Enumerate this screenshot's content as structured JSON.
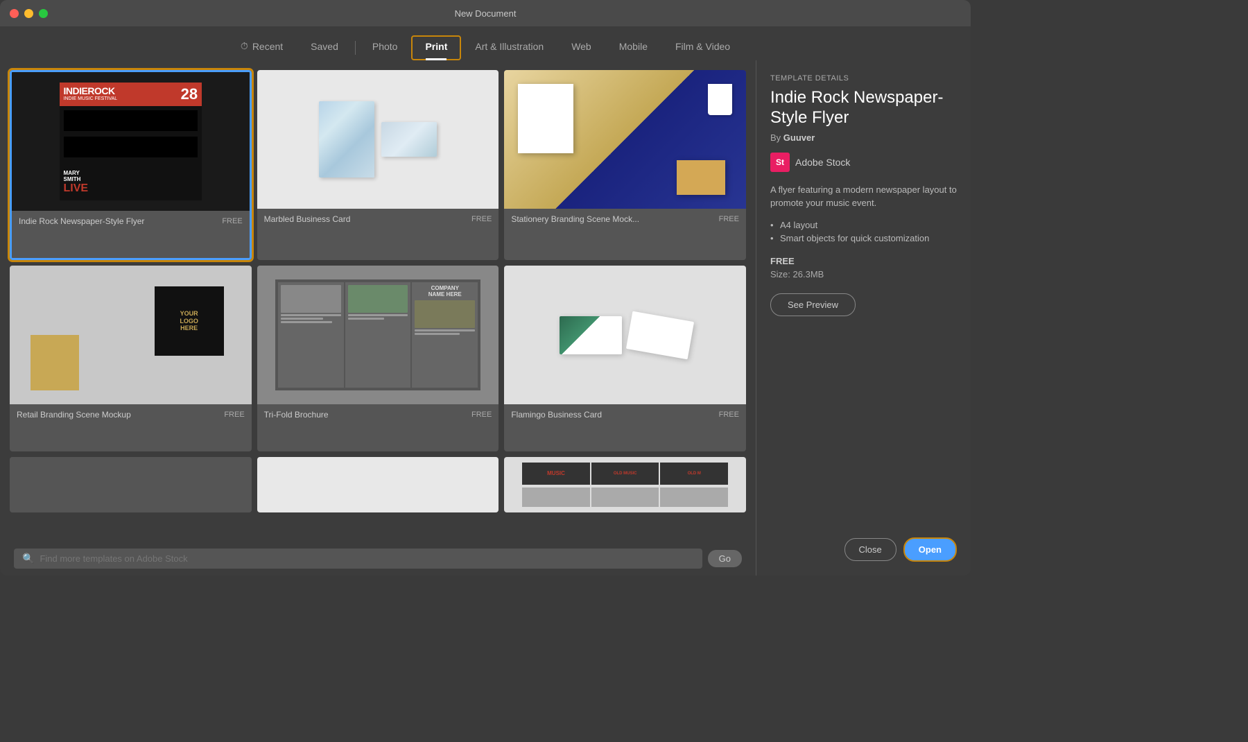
{
  "window": {
    "title": "New Document"
  },
  "nav": {
    "tabs": [
      {
        "id": "recent",
        "label": "Recent",
        "icon": "clock",
        "active": false
      },
      {
        "id": "saved",
        "label": "Saved",
        "active": false
      },
      {
        "id": "photo",
        "label": "Photo",
        "active": false
      },
      {
        "id": "print",
        "label": "Print",
        "active": true
      },
      {
        "id": "art-illustration",
        "label": "Art & Illustration",
        "active": false
      },
      {
        "id": "web",
        "label": "Web",
        "active": false
      },
      {
        "id": "mobile",
        "label": "Mobile",
        "active": false
      },
      {
        "id": "film-video",
        "label": "Film & Video",
        "active": false
      }
    ]
  },
  "templates": [
    {
      "id": "indie-rock",
      "name": "Indie Rock Newspaper-Style Flyer",
      "badge": "FREE",
      "selected": true,
      "thumb_type": "indie"
    },
    {
      "id": "marbled-business-card",
      "name": "Marbled Business Card",
      "badge": "FREE",
      "selected": false,
      "thumb_type": "marble"
    },
    {
      "id": "stationery-branding",
      "name": "Stationery Branding Scene Mock...",
      "badge": "FREE",
      "selected": false,
      "thumb_type": "stationery"
    },
    {
      "id": "retail-branding",
      "name": "Retail Branding Scene Mockup",
      "badge": "FREE",
      "selected": false,
      "thumb_type": "retail"
    },
    {
      "id": "tri-fold-brochure",
      "name": "Tri-Fold Brochure",
      "badge": "FREE",
      "selected": false,
      "thumb_type": "brochure"
    },
    {
      "id": "flamingo-business-card",
      "name": "Flamingo Business Card",
      "badge": "FREE",
      "selected": false,
      "thumb_type": "flamingo"
    },
    {
      "id": "partial1",
      "name": "",
      "badge": "",
      "selected": false,
      "thumb_type": "partial1"
    },
    {
      "id": "partial2",
      "name": "",
      "badge": "",
      "selected": false,
      "thumb_type": "partial2"
    },
    {
      "id": "partial3",
      "name": "",
      "badge": "",
      "selected": false,
      "thumb_type": "partial3"
    }
  ],
  "search": {
    "placeholder": "Find more templates on Adobe Stock",
    "go_label": "Go"
  },
  "sidebar": {
    "section_label": "TEMPLATE DETAILS",
    "title": "Indie Rock Newspaper-Style Flyer",
    "author_prefix": "By",
    "author": "Guuver",
    "stock_label": "Adobe Stock",
    "stock_badge": "St",
    "description": "A flyer featuring a modern newspaper layout to promote your music event.",
    "bullets": [
      "A4 layout",
      "Smart objects for quick customization"
    ],
    "price": "FREE",
    "size_label": "Size:",
    "size_value": "26.3MB",
    "preview_label": "See Preview",
    "close_label": "Close",
    "open_label": "Open"
  }
}
